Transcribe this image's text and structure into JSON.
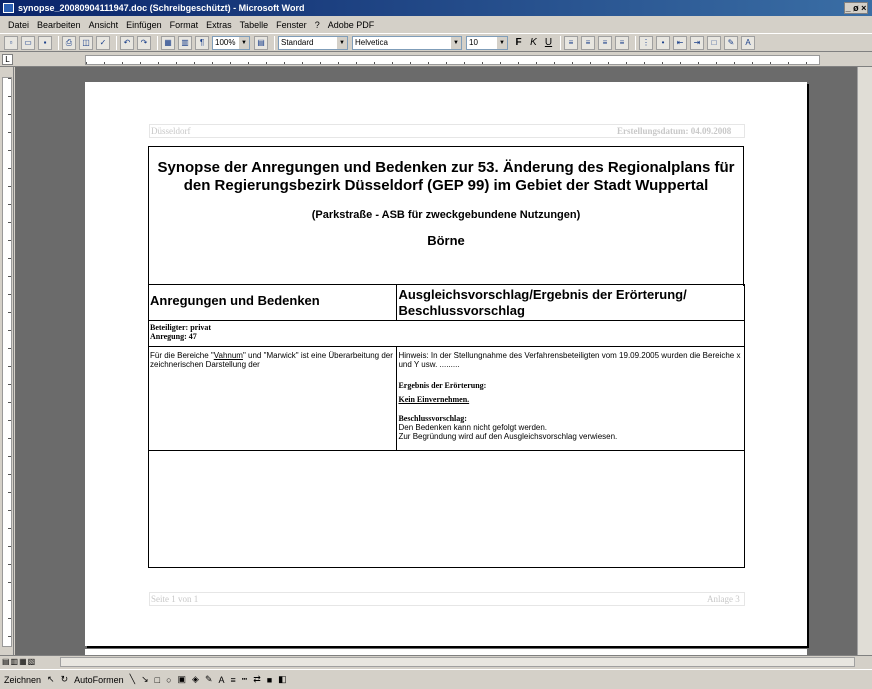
{
  "window": {
    "title": "synopse_20080904111947.doc (Schreibgeschützt) - Microsoft Word",
    "controls": "_ ø ×"
  },
  "menu": [
    "Datei",
    "Bearbeiten",
    "Ansicht",
    "Einfügen",
    "Format",
    "Extras",
    "Tabelle",
    "Fenster",
    "?",
    "Adobe PDF"
  ],
  "toolbar": {
    "zoom": "100%",
    "style": "Standard",
    "font": "Helvetica",
    "size": "10"
  },
  "document": {
    "header_left": "Düsseldorf",
    "header_right": "Erstellungsdatum: 04.09.2008",
    "title": "Synopse der Anregungen und Bedenken zur 53. Änderung des Regionalplans für den Regierungsbezirk Düsseldorf (GEP 99) im Gebiet der Stadt Wuppertal",
    "subtitle": "(Parkstraße - ASB für zweckgebundene Nutzungen)",
    "place": "Börne",
    "col_left": "Anregungen und Bedenken",
    "col_right": "Ausgleichsvorschlag/Ergebnis der Erörterung/ Beschlussvorschlag",
    "beteiligter": "Beteiligter: privat",
    "anregung": "Anregung: 47",
    "left_text_1": "Für die Bereiche \"",
    "left_text_link": "Vahnum",
    "left_text_2": "\" und \"Marwick\" ist eine Überarbeitung der zeichnerischen Darstellung der",
    "hinweis": "Hinweis: In der Stellungnahme des Verfahrensbeteiligten vom 19.09.2005 wurden die Bereiche x und Y usw. .........",
    "ergebnis_label": "Ergebnis der Erörterung:",
    "ergebnis_value": "Kein Einvernehmen.",
    "beschluss_label": "Beschlussvorschlag:",
    "beschluss_1": "Den Bedenken kann nicht gefolgt werden.",
    "beschluss_2": "Zur Begründung wird auf den Ausgleichsvorschlag verwiesen.",
    "footer_left": "Seite 1 von 1",
    "footer_right": "Anlage 3"
  },
  "drawbar": {
    "draw": "Zeichnen",
    "autoshapes": "AutoFormen"
  }
}
